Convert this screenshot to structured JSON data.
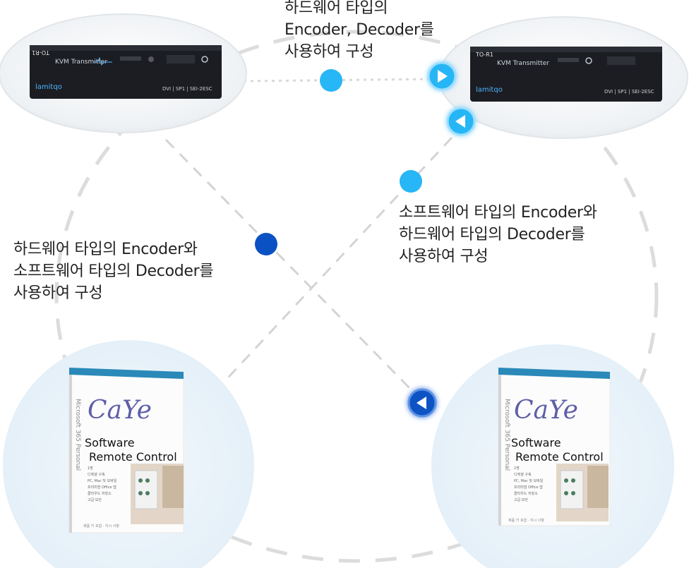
{
  "colors": {
    "dash_line": "#dcdcdc",
    "dot_light": "#27b6f6",
    "dot_dark": "#0a52c4",
    "caption_text": "#222222",
    "device_body": "#1b1d22",
    "product_logo": "#5e5ea8"
  },
  "captions": {
    "top": {
      "line1": "하드웨어 타입의",
      "line2": "Encoder, Decoder를",
      "line3": "사용하여 구성"
    },
    "right": {
      "line1": "소프트웨어 타입의 Encoder와",
      "line2": "하드웨어 타입의 Decoder를",
      "line3": "사용하여 구성"
    },
    "left": {
      "line1": "하드웨어 타입의 Encoder와",
      "line2": "소프트웨어 타입의 Decoder를",
      "line3": "사용하여 구성"
    }
  },
  "device": {
    "model_label": "DVI | SP1 | SEI-2ESC",
    "title_text": "KVM Transmitter",
    "brand": "lamitqo",
    "port_label": "TO-R1"
  },
  "product": {
    "logo": "CaYe",
    "title_line1": "Software",
    "title_line2": "Remote Control",
    "side_text": "Microsoft 365  Personal",
    "bullets": [
      "1명",
      "디렉셜 구축",
      "PC, Mac 및 모바일",
      "프리미엄 Office 앱",
      "클라우드 저장소",
      "고급 보안"
    ],
    "footer": "제품 키 포함 · 지시 사항"
  },
  "icons": {
    "arrow_right": "play-right-icon",
    "arrow_left": "play-left-icon",
    "arrow_left_dark": "play-left-icon"
  }
}
